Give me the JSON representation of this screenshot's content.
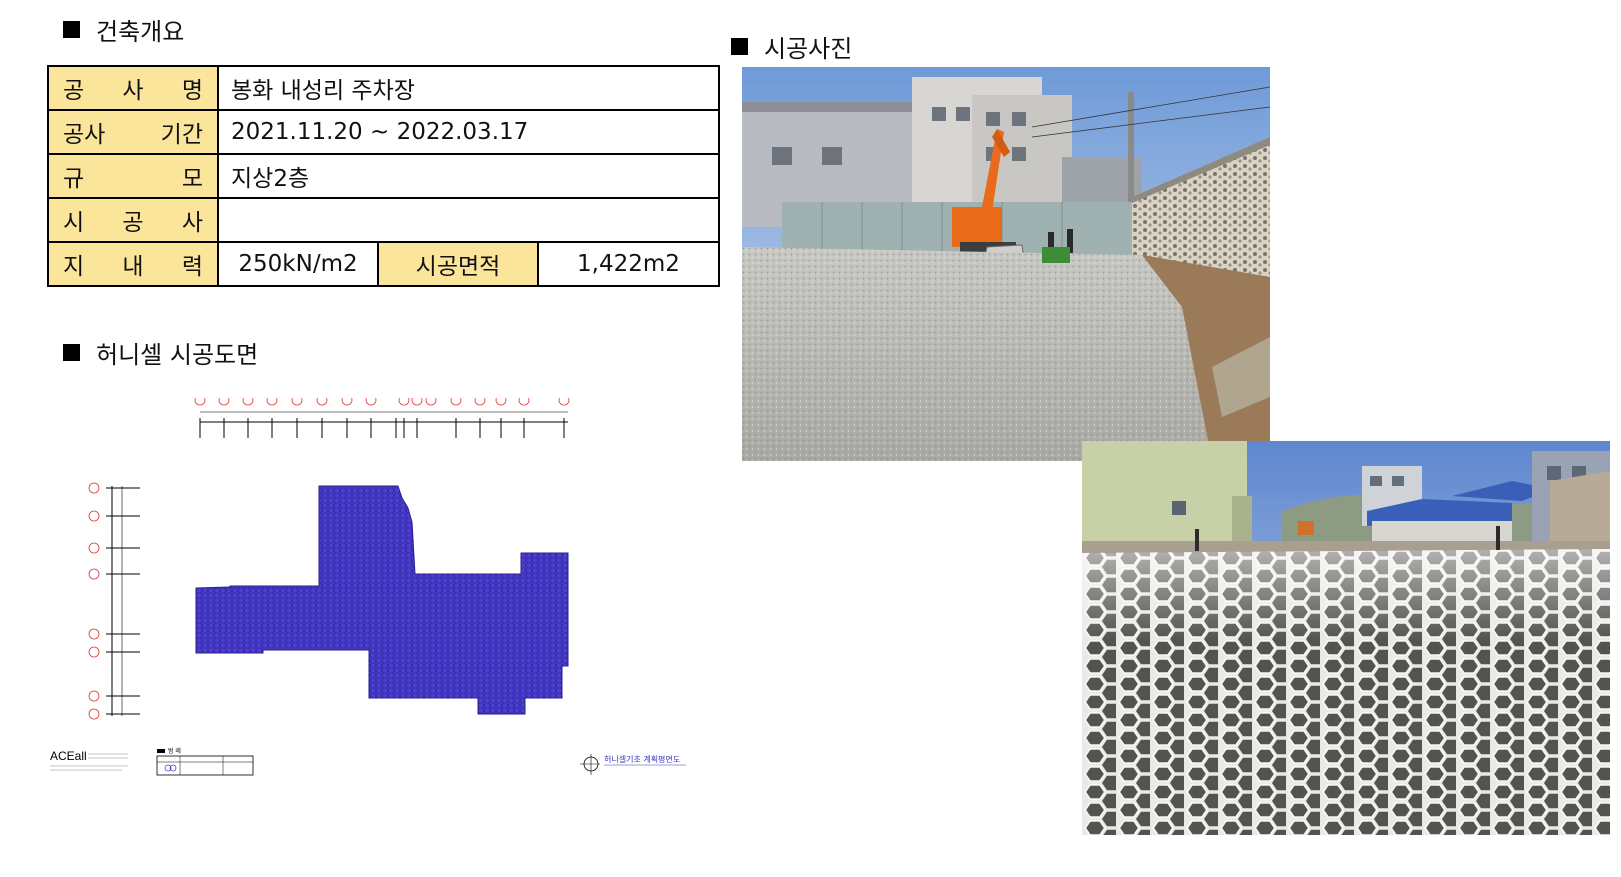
{
  "sections": {
    "overview": "건축개요",
    "photos": "시공사진",
    "drawing": "허니셀 시공도면"
  },
  "table": {
    "rows": [
      {
        "label_chars": [
          "공",
          "사",
          "명"
        ],
        "value": "봉화 내성리 주차장"
      },
      {
        "label_chars": [
          "공사",
          "기간"
        ],
        "value": "2021.11.20  ~ 2022.03.17"
      },
      {
        "label_chars": [
          "규",
          "모"
        ],
        "value": "지상2층"
      },
      {
        "label_chars": [
          "시",
          "공",
          "사"
        ],
        "value": ""
      }
    ],
    "last_row": {
      "label_chars": [
        "지",
        "내",
        "력"
      ],
      "bearing": "250kN/m2",
      "area_label": "시공면적",
      "area": "1,422m2"
    }
  },
  "drawing_plan": {
    "logo": "ACEall",
    "title": "허니셀기초 계획평면도",
    "legend_title": "범 례"
  },
  "colors": {
    "label_bg": "#fbe59a",
    "cell_fill": "#4a3fd0"
  }
}
